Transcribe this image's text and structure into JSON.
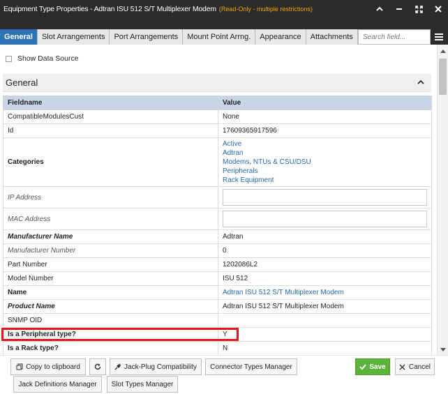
{
  "window": {
    "title": "Equipment Type Properties - Adtran ISU 512 S/T Multiplexer Modem",
    "readonly_note": "(Read-Only - multiple restrictions)",
    "controls": [
      "collapse-icon",
      "minimize-icon",
      "expand-icon",
      "close-icon"
    ]
  },
  "tabs": [
    {
      "label": "General",
      "active": true
    },
    {
      "label": "Slot Arrangements"
    },
    {
      "label": "Port Arrangements"
    },
    {
      "label": "Mount Point Arrng."
    },
    {
      "label": "Appearance"
    },
    {
      "label": "Attachments"
    }
  ],
  "search": {
    "placeholder": "Search field..."
  },
  "show_data_source": {
    "label": "Show Data Source",
    "checked": false
  },
  "section": {
    "title": "General"
  },
  "table": {
    "headers": {
      "field": "Fieldname",
      "value": "Value"
    },
    "rows": [
      {
        "field": "CompatibleModulesCust",
        "value": "None"
      },
      {
        "field": "Id",
        "value": "17609365917596"
      },
      {
        "field": "Categories",
        "values": [
          "Active",
          "Adtran",
          "Modems, NTUs & CSU/DSU",
          "Peripherals",
          "Rack Equipment"
        ]
      },
      {
        "field": "IP Address",
        "value": ""
      },
      {
        "field": "MAC Address",
        "value": ""
      },
      {
        "field": "Manufacturer Name",
        "value": "Adtran"
      },
      {
        "field": "Manufacturer Number",
        "value": "0"
      },
      {
        "field": "Part Number",
        "value": "1202086L2"
      },
      {
        "field": "Model Number",
        "value": "ISU 512"
      },
      {
        "field": "Name",
        "value": "Adtran ISU 512 S/T Multiplexer Modem"
      },
      {
        "field": "Product Name",
        "value": "Adtran ISU 512 S/T Multiplexer Modem"
      },
      {
        "field": "SNMP OID",
        "value": ""
      },
      {
        "field": "Is a Peripheral type?",
        "value": "Y"
      },
      {
        "field": "Is a Rack type?",
        "value": "N"
      }
    ]
  },
  "footer": {
    "copy": "Copy to clipboard",
    "jack_plug": "Jack-Plug Compatibility",
    "connector": "Connector Types Manager",
    "save": "Save",
    "cancel": "Cancel",
    "jack_def": "Jack Definitions Manager",
    "slot_types": "Slot Types Manager"
  },
  "colors": {
    "accent": "#2e74b5",
    "save": "#5cb33c",
    "highlight": "#e2141c",
    "readonly": "#f0a500"
  }
}
